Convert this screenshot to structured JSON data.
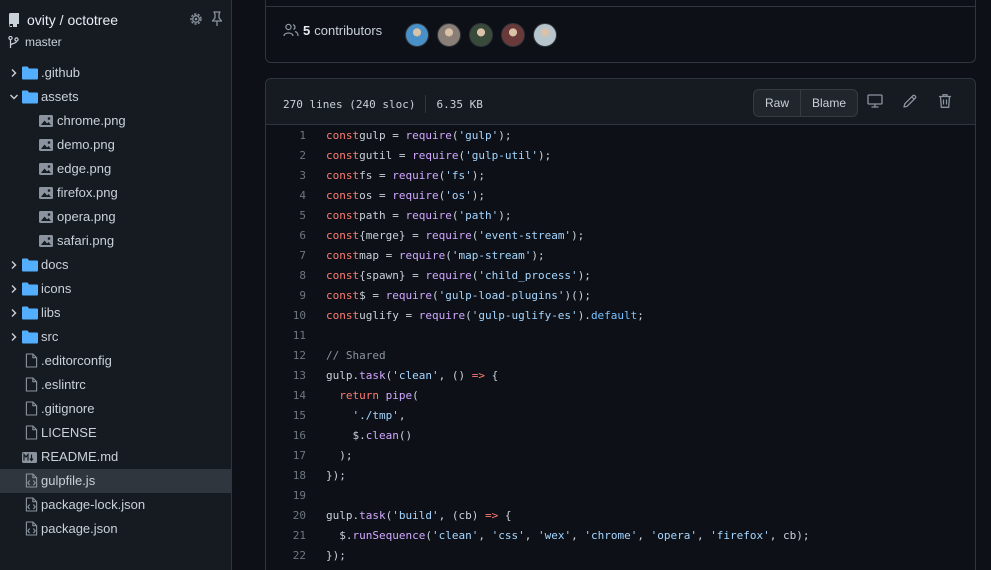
{
  "sidebar": {
    "repo": "ovity / octotree",
    "branch": "master",
    "tree": [
      {
        "type": "folder",
        "name": ".github",
        "depth": 0,
        "expanded": false,
        "selected": false
      },
      {
        "type": "folder",
        "name": "assets",
        "depth": 0,
        "expanded": true,
        "selected": false
      },
      {
        "type": "image",
        "name": "chrome.png",
        "depth": 1,
        "selected": false
      },
      {
        "type": "image",
        "name": "demo.png",
        "depth": 1,
        "selected": false
      },
      {
        "type": "image",
        "name": "edge.png",
        "depth": 1,
        "selected": false
      },
      {
        "type": "image",
        "name": "firefox.png",
        "depth": 1,
        "selected": false
      },
      {
        "type": "image",
        "name": "opera.png",
        "depth": 1,
        "selected": false
      },
      {
        "type": "image",
        "name": "safari.png",
        "depth": 1,
        "selected": false
      },
      {
        "type": "folder",
        "name": "docs",
        "depth": 0,
        "expanded": false,
        "selected": false
      },
      {
        "type": "folder",
        "name": "icons",
        "depth": 0,
        "expanded": false,
        "selected": false
      },
      {
        "type": "folder",
        "name": "libs",
        "depth": 0,
        "expanded": false,
        "selected": false
      },
      {
        "type": "folder",
        "name": "src",
        "depth": 0,
        "expanded": false,
        "selected": false
      },
      {
        "type": "file",
        "name": ".editorconfig",
        "depth": 0,
        "selected": false
      },
      {
        "type": "file",
        "name": ".eslintrc",
        "depth": 0,
        "selected": false
      },
      {
        "type": "file",
        "name": ".gitignore",
        "depth": 0,
        "selected": false
      },
      {
        "type": "file",
        "name": "LICENSE",
        "depth": 0,
        "selected": false
      },
      {
        "type": "markdown",
        "name": "README.md",
        "depth": 0,
        "selected": false
      },
      {
        "type": "code",
        "name": "gulpfile.js",
        "depth": 0,
        "selected": true
      },
      {
        "type": "code",
        "name": "package-lock.json",
        "depth": 0,
        "selected": false
      },
      {
        "type": "code",
        "name": "package.json",
        "depth": 0,
        "selected": false
      }
    ]
  },
  "contributors": {
    "count": "5",
    "label": "contributors",
    "avatar_colors": [
      "#4a90c8",
      "#8a7f76",
      "#3a4a3a",
      "#6a3a3a",
      "#b8c4cc"
    ]
  },
  "file": {
    "lines_info": "270 lines (240 sloc)",
    "size": "6.35 KB",
    "raw_label": "Raw",
    "blame_label": "Blame"
  },
  "code_lines": [
    {
      "n": "1",
      "t": [
        [
          "kw",
          "const"
        ],
        [
          "",
          "gulp = "
        ],
        [
          "fn",
          "require"
        ],
        [
          "",
          "("
        ],
        [
          "str",
          "'gulp'"
        ],
        [
          "",
          ");"
        ]
      ]
    },
    {
      "n": "2",
      "t": [
        [
          "kw",
          "const"
        ],
        [
          "",
          "gutil = "
        ],
        [
          "fn",
          "require"
        ],
        [
          "",
          "("
        ],
        [
          "str",
          "'gulp-util'"
        ],
        [
          "",
          ");"
        ]
      ]
    },
    {
      "n": "3",
      "t": [
        [
          "kw",
          "const"
        ],
        [
          "",
          "fs = "
        ],
        [
          "fn",
          "require"
        ],
        [
          "",
          "("
        ],
        [
          "str",
          "'fs'"
        ],
        [
          "",
          ");"
        ]
      ]
    },
    {
      "n": "4",
      "t": [
        [
          "kw",
          "const"
        ],
        [
          "",
          "os = "
        ],
        [
          "fn",
          "require"
        ],
        [
          "",
          "("
        ],
        [
          "str",
          "'os'"
        ],
        [
          "",
          ");"
        ]
      ]
    },
    {
      "n": "5",
      "t": [
        [
          "kw",
          "const"
        ],
        [
          "",
          "path = "
        ],
        [
          "fn",
          "require"
        ],
        [
          "",
          "("
        ],
        [
          "str",
          "'path'"
        ],
        [
          "",
          ");"
        ]
      ]
    },
    {
      "n": "6",
      "t": [
        [
          "kw",
          "const"
        ],
        [
          "",
          "{merge} = "
        ],
        [
          "fn",
          "require"
        ],
        [
          "",
          "("
        ],
        [
          "str",
          "'event-stream'"
        ],
        [
          "",
          ");"
        ]
      ]
    },
    {
      "n": "7",
      "t": [
        [
          "kw",
          "const"
        ],
        [
          "",
          "map = "
        ],
        [
          "fn",
          "require"
        ],
        [
          "",
          "("
        ],
        [
          "str",
          "'map-stream'"
        ],
        [
          "",
          ");"
        ]
      ]
    },
    {
      "n": "8",
      "t": [
        [
          "kw",
          "const"
        ],
        [
          "",
          "{spawn} = "
        ],
        [
          "fn",
          "require"
        ],
        [
          "",
          "("
        ],
        [
          "str",
          "'child_process'"
        ],
        [
          "",
          ");"
        ]
      ]
    },
    {
      "n": "9",
      "t": [
        [
          "kw",
          "const"
        ],
        [
          "",
          "$ = "
        ],
        [
          "fn",
          "require"
        ],
        [
          "",
          "("
        ],
        [
          "str",
          "'gulp-load-plugins'"
        ],
        [
          "",
          ")();"
        ]
      ]
    },
    {
      "n": "10",
      "t": [
        [
          "kw",
          "const"
        ],
        [
          "",
          "uglify = "
        ],
        [
          "fn",
          "require"
        ],
        [
          "",
          "("
        ],
        [
          "str",
          "'gulp-uglify-es'"
        ],
        [
          "",
          ")."
        ],
        [
          "prop",
          "default"
        ],
        [
          "",
          ";"
        ]
      ]
    },
    {
      "n": "11",
      "t": []
    },
    {
      "n": "12",
      "t": [
        [
          "cm",
          "// Shared"
        ]
      ]
    },
    {
      "n": "13",
      "t": [
        [
          "",
          "gulp."
        ],
        [
          "fn",
          "task"
        ],
        [
          "",
          "("
        ],
        [
          "str",
          "'clean'"
        ],
        [
          "",
          ", () "
        ],
        [
          "kw",
          "=>"
        ],
        [
          "",
          " {"
        ]
      ]
    },
    {
      "n": "14",
      "t": [
        [
          "",
          "  "
        ],
        [
          "kw",
          "return"
        ],
        [
          "",
          " "
        ],
        [
          "fn",
          "pipe"
        ],
        [
          "",
          "("
        ]
      ]
    },
    {
      "n": "15",
      "t": [
        [
          "",
          "    "
        ],
        [
          "str",
          "'./tmp'"
        ],
        [
          "",
          ","
        ]
      ]
    },
    {
      "n": "16",
      "t": [
        [
          "",
          "    $."
        ],
        [
          "fn",
          "clean"
        ],
        [
          "",
          "()"
        ]
      ]
    },
    {
      "n": "17",
      "t": [
        [
          "",
          "  );"
        ]
      ]
    },
    {
      "n": "18",
      "t": [
        [
          "",
          "});"
        ]
      ]
    },
    {
      "n": "19",
      "t": []
    },
    {
      "n": "20",
      "t": [
        [
          "",
          "gulp."
        ],
        [
          "fn",
          "task"
        ],
        [
          "",
          "("
        ],
        [
          "str",
          "'build'"
        ],
        [
          "",
          ", (cb) "
        ],
        [
          "kw",
          "=>"
        ],
        [
          "",
          " {"
        ]
      ]
    },
    {
      "n": "21",
      "t": [
        [
          "",
          "  $."
        ],
        [
          "fn",
          "runSequence"
        ],
        [
          "",
          "("
        ],
        [
          "str",
          "'clean'"
        ],
        [
          "",
          ", "
        ],
        [
          "str",
          "'css'"
        ],
        [
          "",
          ", "
        ],
        [
          "str",
          "'wex'"
        ],
        [
          "",
          ", "
        ],
        [
          "str",
          "'chrome'"
        ],
        [
          "",
          ", "
        ],
        [
          "str",
          "'opera'"
        ],
        [
          "",
          ", "
        ],
        [
          "str",
          "'firefox'"
        ],
        [
          "",
          ", cb);"
        ]
      ]
    },
    {
      "n": "22",
      "t": [
        [
          "",
          "});"
        ]
      ]
    }
  ]
}
